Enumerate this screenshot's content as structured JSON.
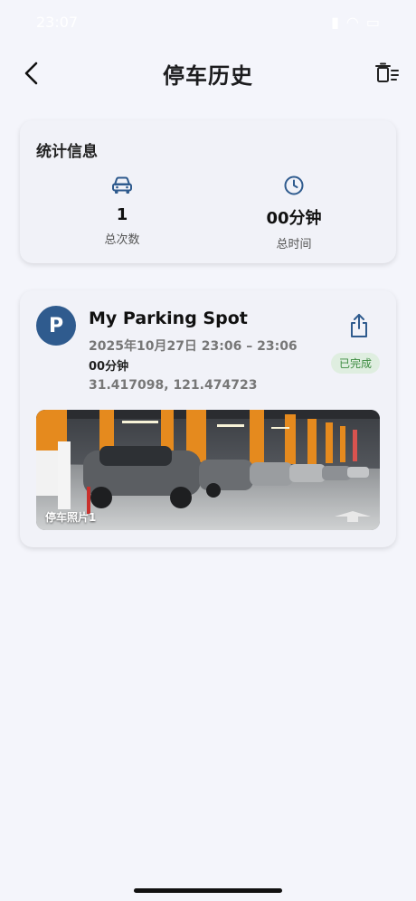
{
  "status_bar": {
    "time": "23:07"
  },
  "header": {
    "title": "停车历史"
  },
  "stats": {
    "title": "统计信息",
    "total_count_value": "1",
    "total_count_label": "总次数",
    "total_time_value": "00分钟",
    "total_time_label": "总时间"
  },
  "records": [
    {
      "avatar_letter": "P",
      "name": "My Parking Spot",
      "time_range": "2025年10月27日 23:06 – 23:06",
      "duration": "00分钟",
      "coordinates": "31.417098, 121.474723",
      "status": "已完成",
      "photo_label": "停车照片1"
    }
  ],
  "colors": {
    "accent": "#2f5b8e",
    "status_green": "#3b8b3f",
    "status_green_bg": "#dfeee0",
    "background": "#f4f5fb"
  },
  "icons": {
    "back": "chevron-left-icon",
    "delete": "trash-icon",
    "car": "car-icon",
    "clock": "clock-icon",
    "share": "share-icon"
  }
}
